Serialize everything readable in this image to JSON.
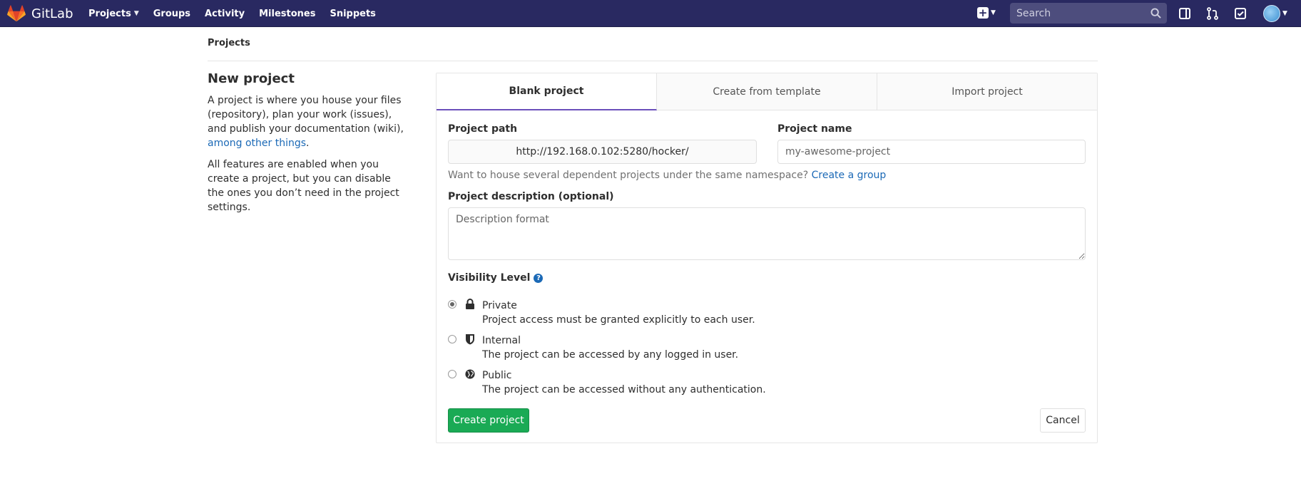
{
  "navbar": {
    "brand": "GitLab",
    "links": [
      {
        "label": "Projects",
        "has_dropdown": true
      },
      {
        "label": "Groups"
      },
      {
        "label": "Activity"
      },
      {
        "label": "Milestones"
      },
      {
        "label": "Snippets"
      }
    ],
    "search_placeholder": "Search",
    "icons": [
      "plus-square-icon",
      "search-icon",
      "sidebar-icon",
      "merge-request-icon",
      "todo-check-icon",
      "avatar"
    ]
  },
  "breadcrumb": "Projects",
  "intro": {
    "title": "New project",
    "para1_text": "A project is where you house your files (repository), plan your work (issues), and publish your documentation (wiki), ",
    "para1_link": "among other things",
    "para1_end": ".",
    "para2": "All features are enabled when you create a project, but you can disable the ones you don’t need in the project settings."
  },
  "tabs": [
    {
      "label": "Blank project",
      "active": true
    },
    {
      "label": "Create from template"
    },
    {
      "label": "Import project"
    }
  ],
  "form": {
    "project_path_label": "Project path",
    "project_path_value": "http://192.168.0.102:5280/hocker/",
    "project_name_label": "Project name",
    "project_name_placeholder": "my-awesome-project",
    "namespace_help": "Want to house several dependent projects under the same namespace? ",
    "namespace_link": "Create a group",
    "description_label": "Project description (optional)",
    "description_placeholder": "Description format",
    "visibility_label": "Visibility Level",
    "visibility_options": [
      {
        "title": "Private",
        "desc": "Project access must be granted explicitly to each user.",
        "checked": true,
        "icon": "lock-icon"
      },
      {
        "title": "Internal",
        "desc": "The project can be accessed by any logged in user.",
        "checked": false,
        "icon": "shield-icon"
      },
      {
        "title": "Public",
        "desc": "The project can be accessed without any authentication.",
        "checked": false,
        "icon": "globe-icon"
      }
    ],
    "create_button": "Create project",
    "cancel_button": "Cancel"
  },
  "colors": {
    "navbar": "#292961",
    "primary_button": "#1aaa55",
    "link": "#1b69b6",
    "active_tab_underline": "#6b4fbb"
  }
}
